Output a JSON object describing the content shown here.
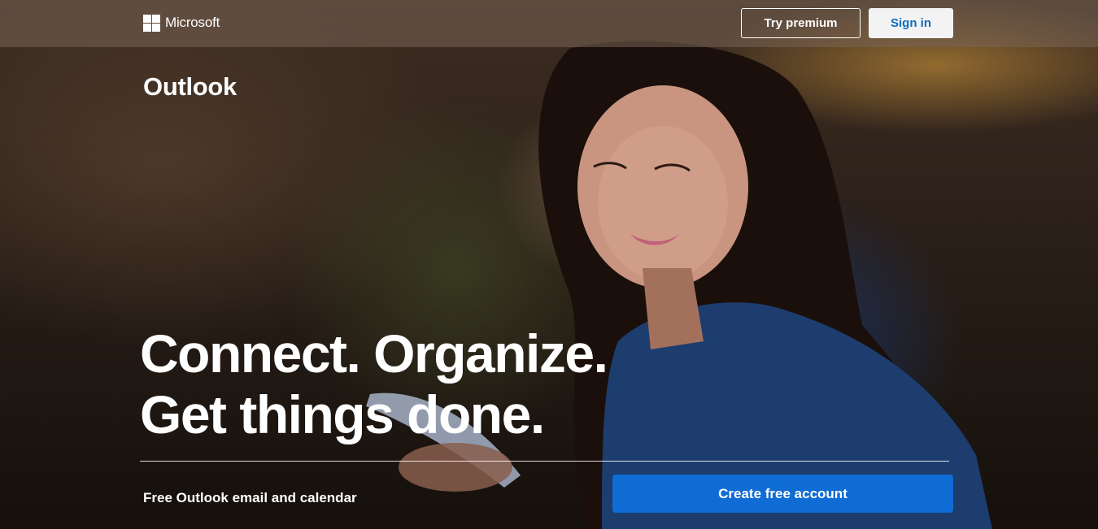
{
  "header": {
    "brand": "Microsoft",
    "try_premium_label": "Try premium",
    "sign_in_label": "Sign in"
  },
  "hero": {
    "product_name": "Outlook",
    "headline_line1": "Connect. Organize.",
    "headline_line2": "Get things done.",
    "tagline": "Free Outlook email and calendar",
    "cta_label": "Create free account"
  },
  "colors": {
    "cta_blue": "#0f6cd4",
    "sign_in_text": "#0f6cbd",
    "text_white": "#ffffff"
  }
}
